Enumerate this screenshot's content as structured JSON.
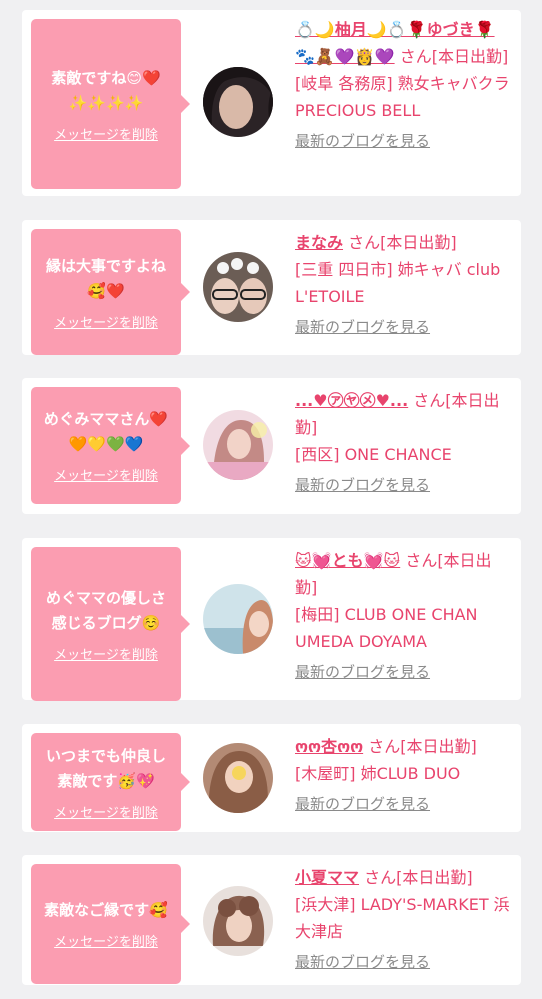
{
  "cards": [
    {
      "message": "素敵ですね😊❤️\n✨✨✨✨",
      "delete_label": "メッセージを削除",
      "name": "💍🌙柚月🌙💍🌹ゆづき🌹🐾🧸💜👸💜",
      "suffix": "さん[本日出勤]",
      "shop": "[岐阜 各務原] 熟女キャバクラ PRECIOUS BELL",
      "blog_label": "最新のブログを見る",
      "avatar_color": "#2b2326"
    },
    {
      "message": "縁は大事ですよね\n🥰❤️",
      "delete_label": "メッセージを削除",
      "name": "まなみ",
      "suffix": "さん[本日出勤]",
      "shop": "[三重 四日市] 姉キャバ club L'ETOILE",
      "blog_label": "最新のブログを見る",
      "avatar_color": "#6b5d55"
    },
    {
      "message": "めぐみママさん❤️\n🧡💛💚💙",
      "delete_label": "メッセージを削除",
      "name": "...♥㋐㋳㋱♥...",
      "suffix": "さん[本日出勤]",
      "shop": "[西区] ONE CHANCE",
      "blog_label": "最新のブログを見る",
      "avatar_color": "#e7b9c6"
    },
    {
      "message": "めぐママの優しさ\n感じるブログ☺️",
      "delete_label": "メッセージを削除",
      "name": "🐱💓とも💓🐱",
      "suffix": "さん[本日出勤]",
      "shop": "[梅田] CLUB ONE CHAN UMEDA DOYAMA",
      "blog_label": "最新のブログを見る",
      "avatar_color": "#bcd6df"
    },
    {
      "message": "いつまでも仲良し\n素敵です🥳💖",
      "delete_label": "メッセージを削除",
      "name": "ოო杏ოო",
      "suffix": "さん[本日出勤]",
      "shop": "[木屋町] 姉CLUB DUO",
      "blog_label": "最新のブログを見る",
      "avatar_color": "#caa089"
    },
    {
      "message": "素敵なご縁です🥰",
      "delete_label": "メッセージを削除",
      "name": "小夏ママ",
      "suffix": "さん[本日出勤]",
      "shop": "[浜大津] LADY'S-MARKET 浜大津店",
      "blog_label": "最新のブログを見る",
      "avatar_color": "#8a6150"
    }
  ]
}
